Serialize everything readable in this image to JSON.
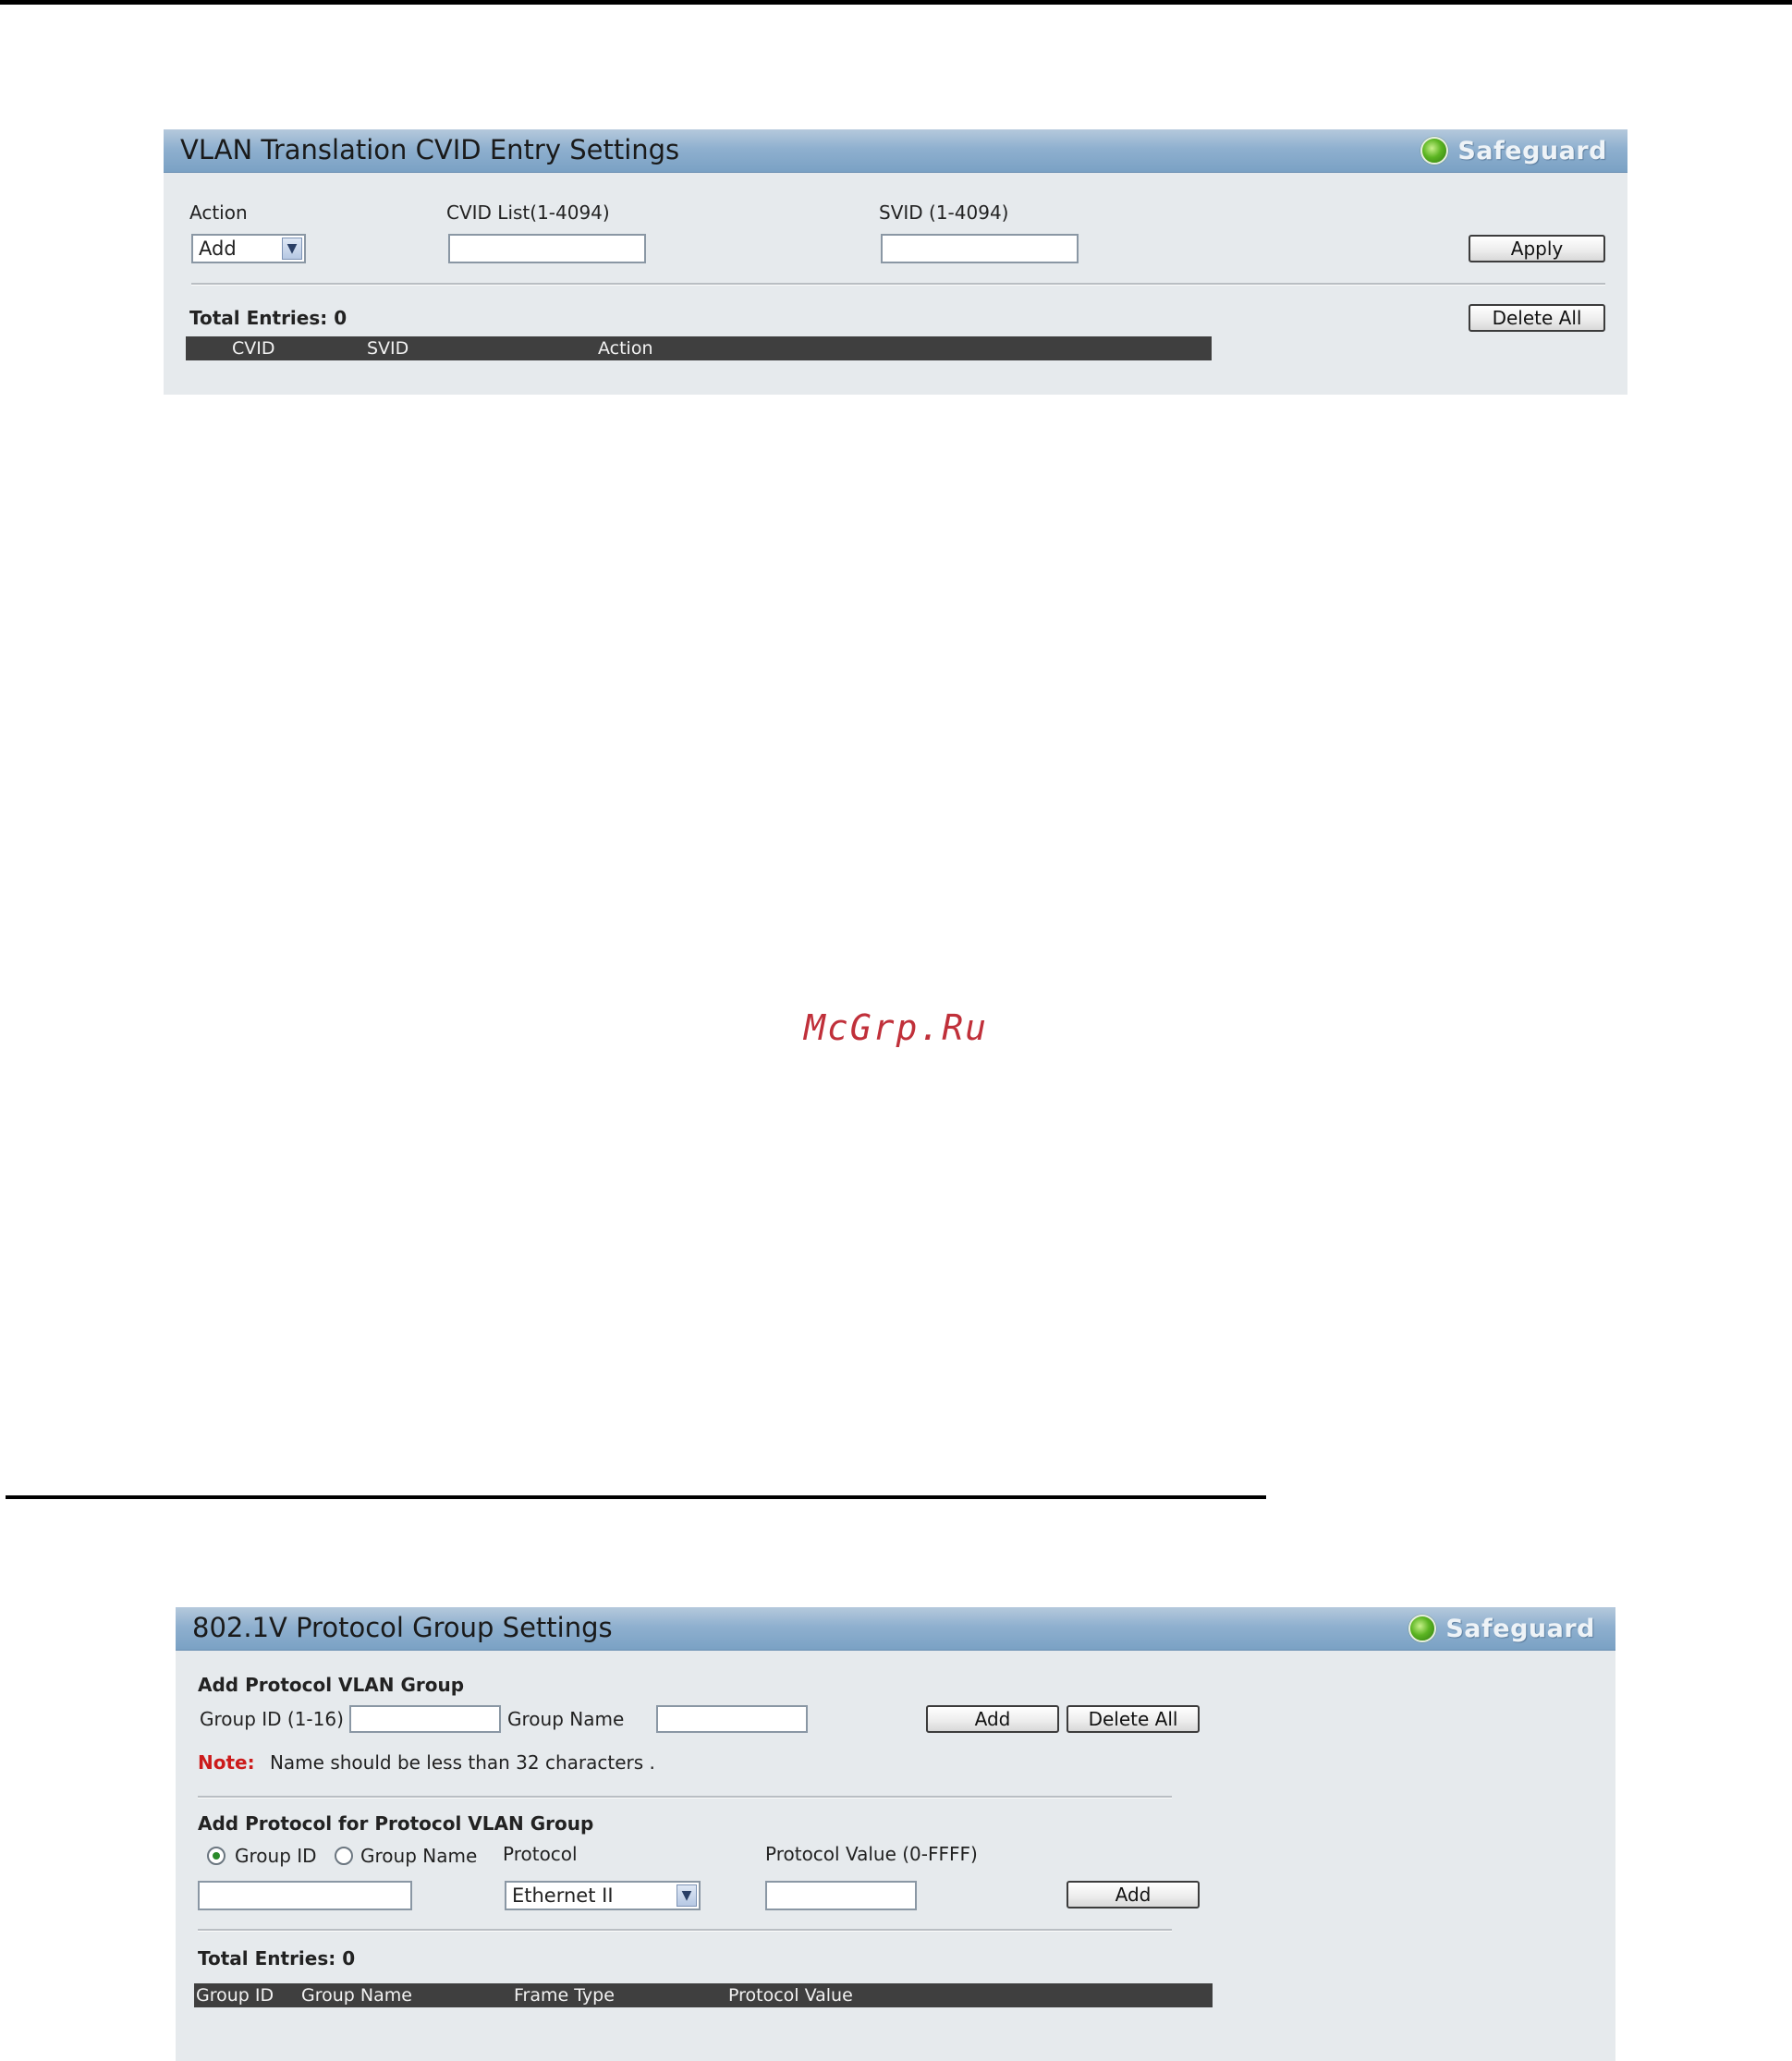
{
  "watermark": "McGrp.Ru",
  "panel1": {
    "title": "VLAN Translation CVID Entry Settings",
    "safeguard": "Safeguard",
    "action_label": "Action",
    "action_value": "Add",
    "cvid_label": "CVID List(1-4094)",
    "svid_label": "SVID (1-4094)",
    "apply_button": "Apply",
    "total_entries": "Total Entries:  0",
    "delete_all_button": "Delete All",
    "columns": [
      "CVID",
      "SVID",
      "Action"
    ]
  },
  "panel2": {
    "title": "802.1V Protocol Group Settings",
    "safeguard": "Safeguard",
    "section1_title": "Add Protocol VLAN Group",
    "group_id_label": "Group ID (1-16)",
    "group_name_label": "Group Name",
    "add_button": "Add",
    "delete_all_button": "Delete All",
    "note_key": "Note:",
    "note_text": "Name should be less than 32 characters .",
    "section2_title": "Add Protocol for Protocol VLAN Group",
    "radio_group_id": "Group ID",
    "radio_group_name": "Group Name",
    "protocol_label": "Protocol",
    "protocol_value": "Ethernet II",
    "protocol_value_label": "Protocol Value (0-FFFF)",
    "add_button2": "Add",
    "total_entries": "Total Entries: 0",
    "columns": [
      "Group ID",
      "Group Name",
      "Frame Type",
      "Protocol Value"
    ]
  },
  "colors": {
    "header_blue": "#7aa1c4",
    "panel_bg": "#e6eaed",
    "table_header": "#3f3f3f",
    "note_red": "#cc1b1b"
  }
}
